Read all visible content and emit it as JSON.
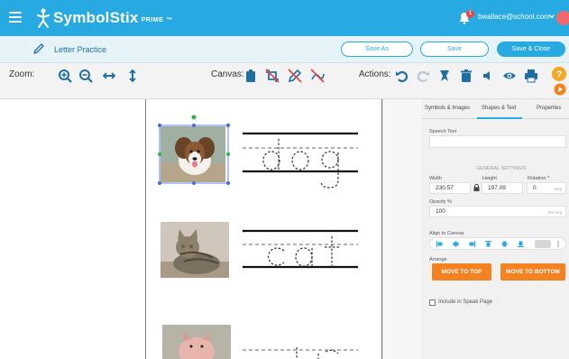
{
  "app": {
    "name": "SymbolStix",
    "edition": "PRIME",
    "trademark": "™",
    "notifications_count": "1",
    "user_email": "bwallace@school.com"
  },
  "document": {
    "title": "Letter Practice",
    "buttons": {
      "save_as": "Save As",
      "save": "Save",
      "save_close": "Save & Close"
    }
  },
  "toolbar": {
    "zoom_label": "Zoom:",
    "canvas_label": "Canvas:",
    "actions_label": "Actions:",
    "icons": [
      "zoom-in",
      "zoom-out",
      "fit-width",
      "fit-height",
      "paste",
      "no-crop",
      "no-edit",
      "no-draw",
      "undo",
      "redo",
      "clear",
      "delete",
      "speak",
      "preview",
      "print",
      "help",
      "play"
    ]
  },
  "canvas": {
    "words": [
      "dog",
      "cat",
      "pig"
    ]
  },
  "panel": {
    "tabs": [
      "Symbols & Images",
      "Shapes & Text",
      "Properties"
    ],
    "active_tab": "Shapes & Text",
    "speech_text_label": "Speech Text",
    "general_settings_label": "GENERAL SETTINGS",
    "width_label": "Width",
    "width_value": "230.57",
    "height_label": "Height",
    "height_value": "197.09",
    "rotation_label": "Rotation *",
    "rotation_value": "0",
    "rotation_unit": "Deg",
    "opacity_label": "Opacity %",
    "opacity_value": "100",
    "opacity_unit": "Percent",
    "align_label": "Align to Canvas",
    "arrange_label": "Arrange",
    "move_to_top": "MOVE TO TOP",
    "move_to_bottom": "MOVE TO BOTTOM",
    "include_label": "Include in Speak Page"
  },
  "colors": {
    "brand_blue": "#27a9e1",
    "accent_orange": "#f58220",
    "nav_blue": "#1e6ea6"
  }
}
